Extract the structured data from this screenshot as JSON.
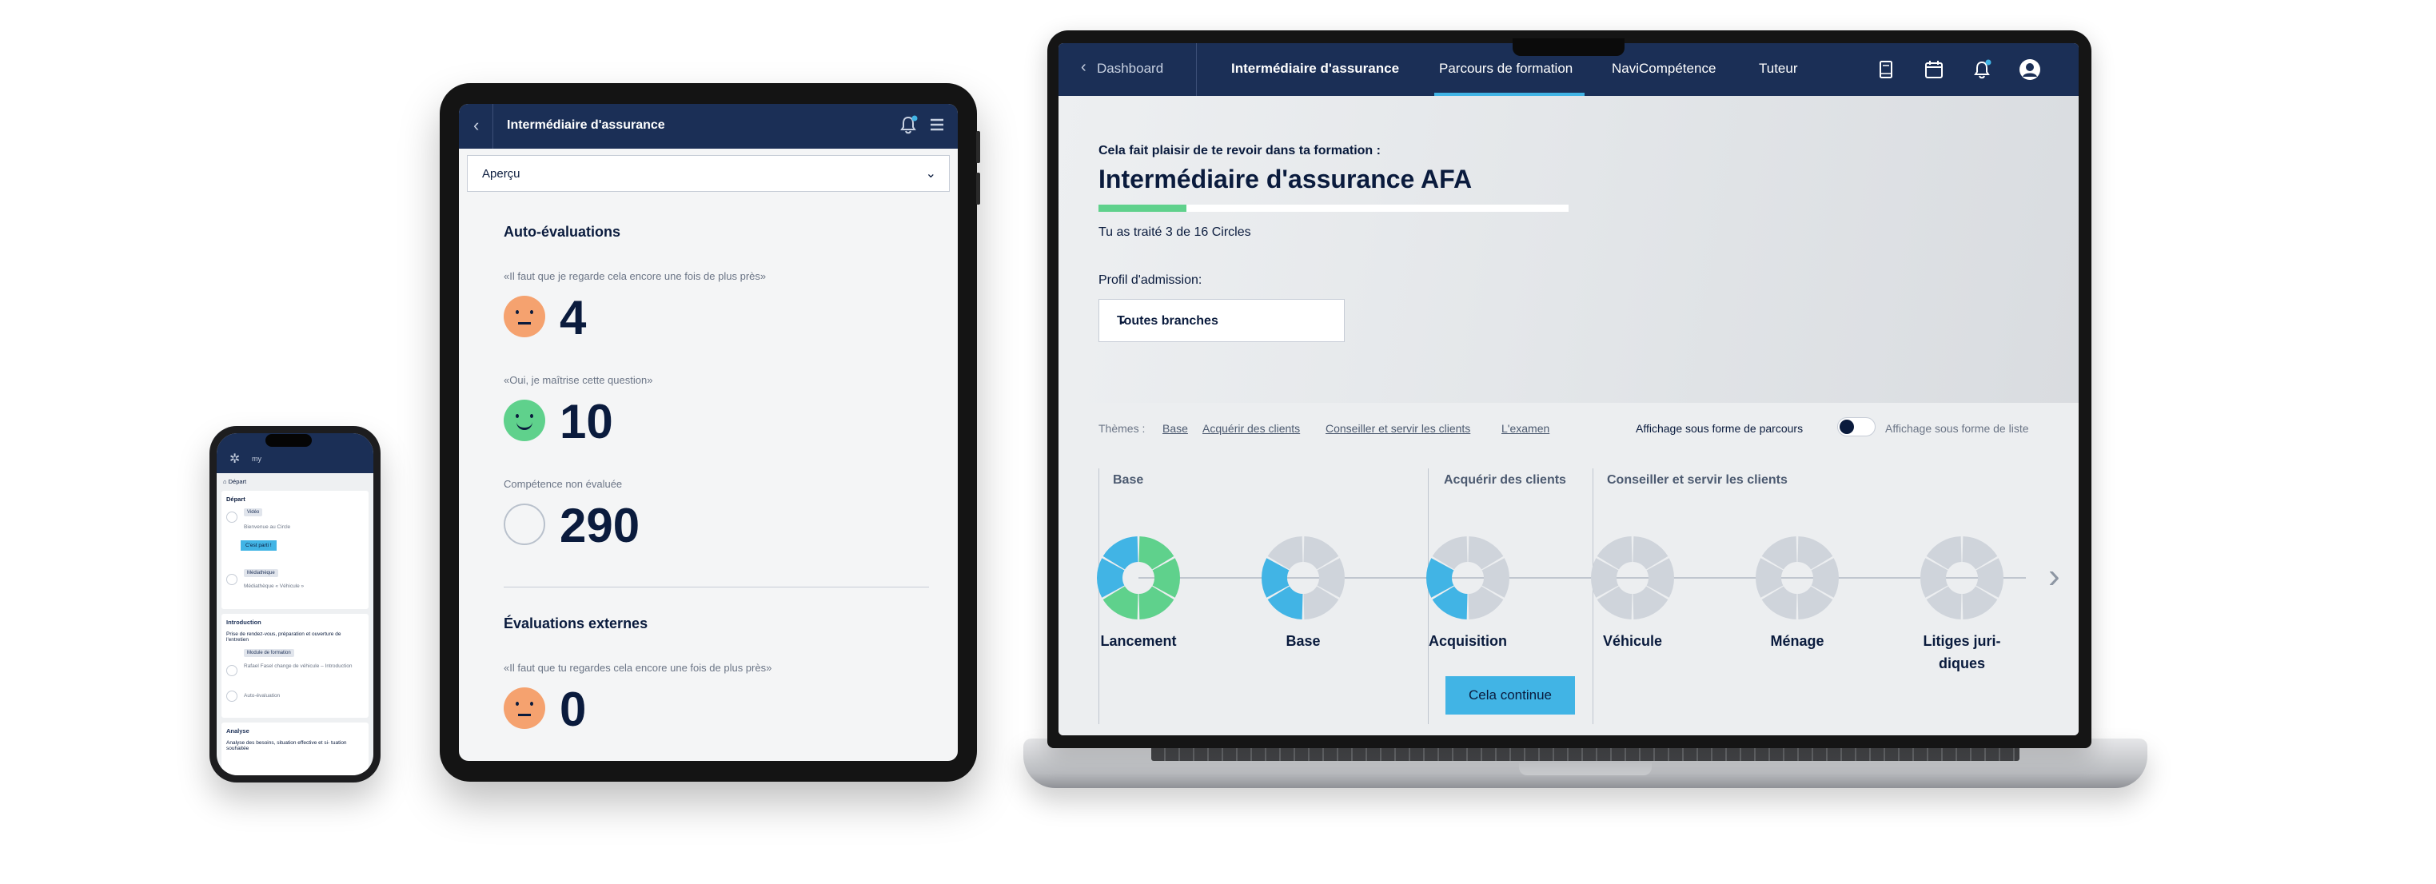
{
  "phone": {
    "brand": "my",
    "section_start": "Départ",
    "item_1": "Départ",
    "chip_video": "Vidéo",
    "item_welcome": "Bienvenue au Circle",
    "button_start": "C'est parti !",
    "chip_mediatheque": "Médiathèque",
    "item_mediatheque": "Médiathèque « Véhicule »",
    "section_intro": "Introduction",
    "intro_text": "Prise de rendez-vous, préparation et ouverture de l'entretien",
    "chip_module": "Module de formation",
    "intro_sub": "Rafael Fasel change de véhicule – Introduction",
    "intro_auto": "Auto-évaluation",
    "section_analyse": "Analyse",
    "analyse_text": "Analyse des besoins, situation effective et si- tuation souhaitée"
  },
  "tablet": {
    "title": "Intermédiaire d'assurance",
    "select_value": "Aperçu",
    "self_heading": "Auto-évaluations",
    "q1": "«Il faut que je regarde cela encore une fois de plus près»",
    "n1": "4",
    "q2": "«Oui, je maîtrise cette question»",
    "n2": "10",
    "q3": "Compétence non évaluée",
    "n3": "290",
    "ext_heading": "Évaluations externes",
    "q4": "«Il faut que tu regardes cela encore une fois de plus près»",
    "n4": "0"
  },
  "laptop": {
    "nav": {
      "back": "Dashboard",
      "brand": "Intermédiaire d'assurance",
      "tab_active": "Parcours de formation",
      "tab_3": "NaviCompétence",
      "tab_4": "Tuteur",
      "icons": [
        "book-icon",
        "calendar-icon",
        "bell-icon",
        "avatar-icon"
      ]
    },
    "hero": {
      "subtitle": "Cela fait plaisir de te revoir dans ta formation :",
      "title": "Intermédiaire d'assurance AFA",
      "progress": {
        "done": 3,
        "total": 16
      },
      "count_text": "Tu as traité 3 de 16 Circles",
      "profile_label": "Profil d'admission:",
      "profile_value": "Toutes branches"
    },
    "themes": {
      "label": "Thèmes :",
      "links": [
        "Base",
        "Acquérir des clients",
        "Conseiller et servir les clients",
        "L'examen"
      ],
      "toggle_a": "Affichage sous forme de parcours",
      "toggle_b": "Affichage sous forme de liste"
    },
    "columns": [
      "Base",
      "Acquérir des clients",
      "Conseiller et servir les clients"
    ],
    "circles": [
      {
        "label": "Lancement",
        "segments": [
          "done",
          "done",
          "done",
          "done",
          "progress",
          "progress"
        ]
      },
      {
        "label": "Base",
        "segments": [
          "todo",
          "todo",
          "todo",
          "progress",
          "progress",
          "todo"
        ]
      },
      {
        "label": "Acquisition",
        "segments": [
          "todo",
          "todo",
          "todo",
          "progress",
          "progress",
          "todo"
        ]
      },
      {
        "label": "Véhicule",
        "segments": [
          "todo",
          "todo",
          "todo",
          "todo",
          "todo",
          "todo"
        ]
      },
      {
        "label": "Ménage",
        "segments": [
          "todo",
          "todo",
          "todo",
          "todo",
          "todo",
          "todo"
        ]
      },
      {
        "label": "Litiges juri-diques",
        "segments": [
          "todo",
          "todo",
          "todo",
          "todo",
          "todo",
          "todo"
        ]
      }
    ],
    "cta": "Cela continue",
    "colors": {
      "done": "#5fd18c",
      "progress": "#41b4e5",
      "todo": "#cfd4db",
      "navy": "#1b2f56"
    }
  }
}
